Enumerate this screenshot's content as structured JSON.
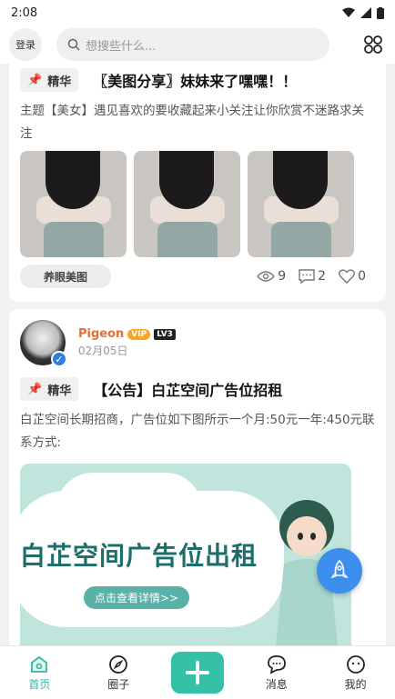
{
  "status": {
    "time": "2:08"
  },
  "header": {
    "login_label": "登录",
    "search_placeholder": "想搜些什么..."
  },
  "post1": {
    "badge": "精华",
    "title": "〖美图分享〗妹妹来了嘿嘿！！",
    "body": "主题【美女】遇见喜欢的要收藏起来小关注让你欣赏不迷路求关注",
    "tag": "养眼美图",
    "views": "9",
    "comments": "2",
    "likes": "0"
  },
  "post2": {
    "username": "Pigeon",
    "vip": "VIP",
    "level": "LV3",
    "date": "02月05日",
    "badge": "精华",
    "title": "【公告】白芷空间广告位招租",
    "body": "白芷空间长期招商，广告位如下图所示一个月:50元一年:450元联系方式:",
    "banner_title": "白芷空间广告位出租",
    "banner_button": "点击查看详情>>"
  },
  "nav": {
    "items": [
      {
        "label": "首页",
        "icon": "home-icon"
      },
      {
        "label": "圈子",
        "icon": "compass-icon"
      },
      {
        "label": "",
        "icon": "add-icon"
      },
      {
        "label": "消息",
        "icon": "message-icon"
      },
      {
        "label": "我的",
        "icon": "profile-icon"
      }
    ]
  },
  "colors": {
    "accent": "#35c1a8",
    "fab": "#3d8fee",
    "username": "#e36f3a"
  }
}
